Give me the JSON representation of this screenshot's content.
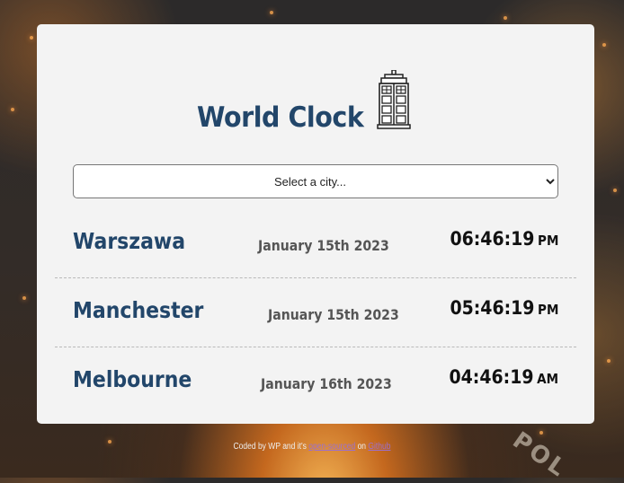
{
  "header": {
    "title": "World Clock",
    "logo_icon": "tardis-police-box-icon"
  },
  "city_select": {
    "selected": "Select a city..."
  },
  "cities": [
    {
      "name": "Warszawa",
      "date": "January 15th 2023",
      "time": "06:46:19",
      "ampm": "PM"
    },
    {
      "name": "Manchester",
      "date": "January 15th 2023",
      "time": "05:46:19",
      "ampm": "PM"
    },
    {
      "name": "Melbourne",
      "date": "January 16th 2023",
      "time": "04:46:19",
      "ampm": "AM"
    }
  ],
  "footer": {
    "prefix": "Coded by WP and it's ",
    "link_1": "open-sourced",
    "middle": " on ",
    "link_2": "Github"
  },
  "background": {
    "sign_text": "POL"
  },
  "colors": {
    "title": "#22466a",
    "card": "#f3f3f3",
    "link": "#9b6fd0"
  }
}
